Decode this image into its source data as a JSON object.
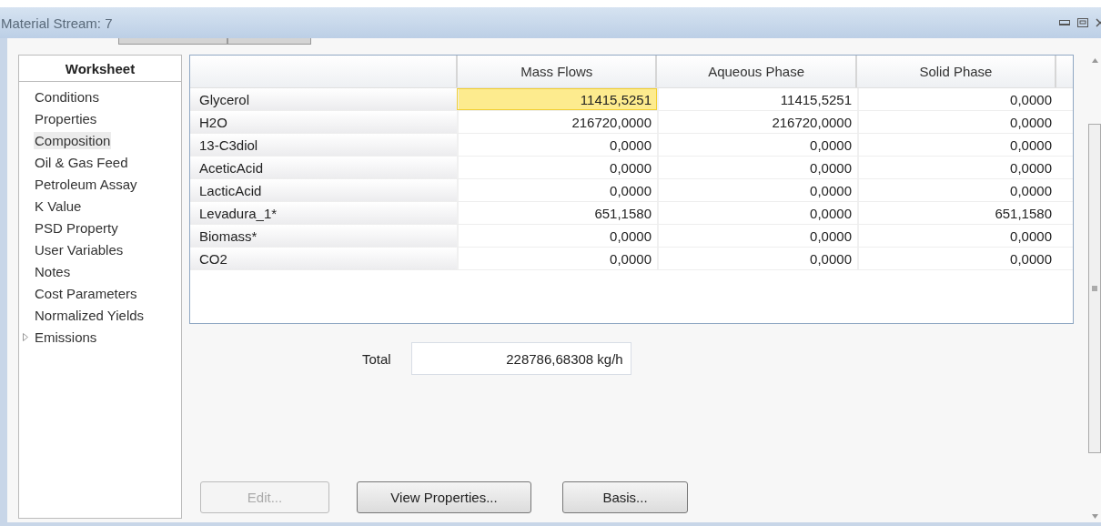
{
  "window": {
    "title": "Material Stream: 7"
  },
  "sidebar": {
    "header": "Worksheet",
    "items": [
      {
        "label": "Conditions",
        "selected": false,
        "kind": "leaf"
      },
      {
        "label": "Properties",
        "selected": false,
        "kind": "leaf"
      },
      {
        "label": "Composition",
        "selected": true,
        "kind": "leaf"
      },
      {
        "label": "Oil & Gas Feed",
        "selected": false,
        "kind": "leaf"
      },
      {
        "label": "Petroleum Assay",
        "selected": false,
        "kind": "leaf"
      },
      {
        "label": "K Value",
        "selected": false,
        "kind": "leaf"
      },
      {
        "label": "PSD Property",
        "selected": false,
        "kind": "leaf"
      },
      {
        "label": "User Variables",
        "selected": false,
        "kind": "leaf"
      },
      {
        "label": "Notes",
        "selected": false,
        "kind": "leaf"
      },
      {
        "label": "Cost Parameters",
        "selected": false,
        "kind": "leaf"
      },
      {
        "label": "Normalized Yields",
        "selected": false,
        "kind": "leaf"
      },
      {
        "label": "Emissions",
        "selected": false,
        "kind": "group"
      }
    ]
  },
  "table": {
    "columns": [
      "Mass Flows",
      "Aqueous Phase",
      "Solid Phase"
    ],
    "rows": [
      {
        "name": "Glycerol",
        "cells": [
          {
            "value": "11415,5251",
            "selected": true
          },
          {
            "value": "11415,5251",
            "selected": false
          },
          {
            "value": "0,0000",
            "selected": false
          }
        ]
      },
      {
        "name": "H2O",
        "cells": [
          {
            "value": "216720,0000",
            "selected": false
          },
          {
            "value": "216720,0000",
            "selected": false
          },
          {
            "value": "0,0000",
            "selected": false
          }
        ]
      },
      {
        "name": "13-C3diol",
        "cells": [
          {
            "value": "0,0000",
            "selected": false
          },
          {
            "value": "0,0000",
            "selected": false
          },
          {
            "value": "0,0000",
            "selected": false
          }
        ]
      },
      {
        "name": "AceticAcid",
        "cells": [
          {
            "value": "0,0000",
            "selected": false
          },
          {
            "value": "0,0000",
            "selected": false
          },
          {
            "value": "0,0000",
            "selected": false
          }
        ]
      },
      {
        "name": "LacticAcid",
        "cells": [
          {
            "value": "0,0000",
            "selected": false
          },
          {
            "value": "0,0000",
            "selected": false
          },
          {
            "value": "0,0000",
            "selected": false
          }
        ]
      },
      {
        "name": "Levadura_1*",
        "cells": [
          {
            "value": "651,1580",
            "selected": false
          },
          {
            "value": "0,0000",
            "selected": false
          },
          {
            "value": "651,1580",
            "selected": false
          }
        ]
      },
      {
        "name": "Biomass*",
        "cells": [
          {
            "value": "0,0000",
            "selected": false
          },
          {
            "value": "0,0000",
            "selected": false
          },
          {
            "value": "0,0000",
            "selected": false
          }
        ]
      },
      {
        "name": "CO2",
        "cells": [
          {
            "value": "0,0000",
            "selected": false
          },
          {
            "value": "0,0000",
            "selected": false
          },
          {
            "value": "0,0000",
            "selected": false
          }
        ]
      }
    ]
  },
  "total": {
    "label": "Total",
    "value": "228786,68308 kg/h"
  },
  "buttons": [
    {
      "label": "Edit...",
      "disabled": true
    },
    {
      "label": "View Properties...",
      "disabled": false
    },
    {
      "label": "Basis...",
      "disabled": false
    }
  ]
}
